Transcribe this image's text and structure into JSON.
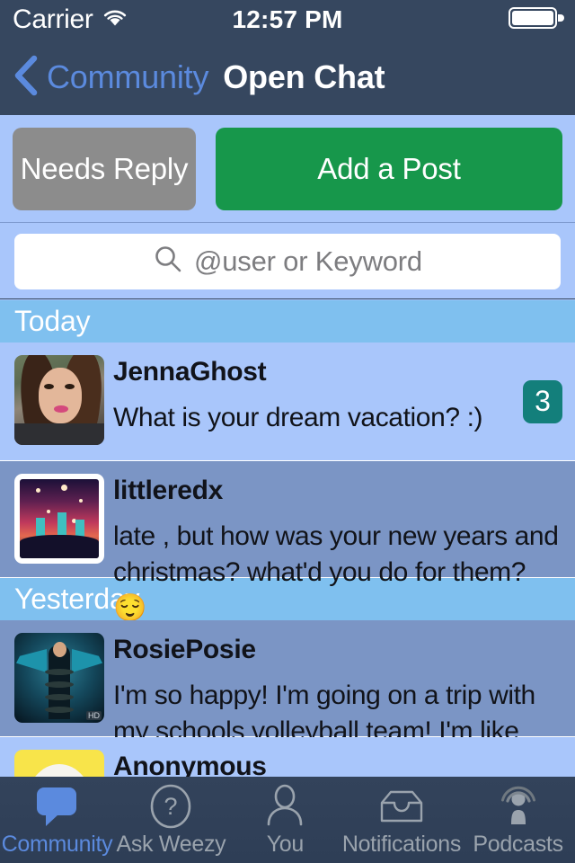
{
  "status_bar": {
    "carrier": "Carrier",
    "wifi_icon": "wifi-icon",
    "time": "12:57 PM",
    "battery_icon": "battery-full-icon"
  },
  "nav_bar": {
    "back_icon": "chevron-left-icon",
    "back_label": "Community",
    "title": "Open Chat"
  },
  "actions": {
    "needs_reply_label": "Needs Reply",
    "needs_reply_color": "#8c8c8c",
    "add_post_label": "Add a Post",
    "add_post_color": "#17974b"
  },
  "search": {
    "icon": "search-icon",
    "placeholder": "@user or Keyword",
    "value": ""
  },
  "list": {
    "sections": [
      {
        "header": "Today",
        "rows": [
          {
            "avatar": "av-jenna",
            "avatar_name": "avatar-jennaghost",
            "user": "JennaGhost",
            "text": "What is your dream vacation?  :)",
            "badge": "3",
            "badge_color": "#137f7b",
            "row_bg": "#a9c6fb"
          },
          {
            "avatar": "av-concert",
            "avatar_name": "avatar-littleredx",
            "user": "littleredx",
            "text": "late , but how was your new years and christmas? what'd you do for them? 😌",
            "badge": "",
            "row_bg": "#7b95c5"
          }
        ]
      },
      {
        "header": "Yesterday",
        "rows": [
          {
            "avatar": "av-rosie",
            "avatar_name": "avatar-rosieposie",
            "user": "RosiePosie",
            "text": "I'm so happy! I'm going on a trip with my schools volleyball team! I'm like sc…",
            "badge": "",
            "row_bg": "#7b95c5"
          },
          {
            "avatar": "av-anon",
            "avatar_name": "avatar-anonymous",
            "user": "Anonymous",
            "text": "",
            "badge": "",
            "row_bg": "#a9c6fb"
          }
        ]
      }
    ],
    "section_header_color": "#7fc0ef"
  },
  "tab_bar": {
    "active_color": "#5b8ade",
    "inactive_color": "#9aa3ad",
    "tabs": [
      {
        "label": "Community",
        "icon": "speech-bubble-icon",
        "active": true
      },
      {
        "label": "Ask Weezy",
        "icon": "question-circle-icon",
        "active": false
      },
      {
        "label": "You",
        "icon": "person-icon",
        "active": false
      },
      {
        "label": "Notifications",
        "icon": "inbox-tray-icon",
        "active": false
      },
      {
        "label": "Podcasts",
        "icon": "podcast-icon",
        "active": false
      }
    ]
  }
}
